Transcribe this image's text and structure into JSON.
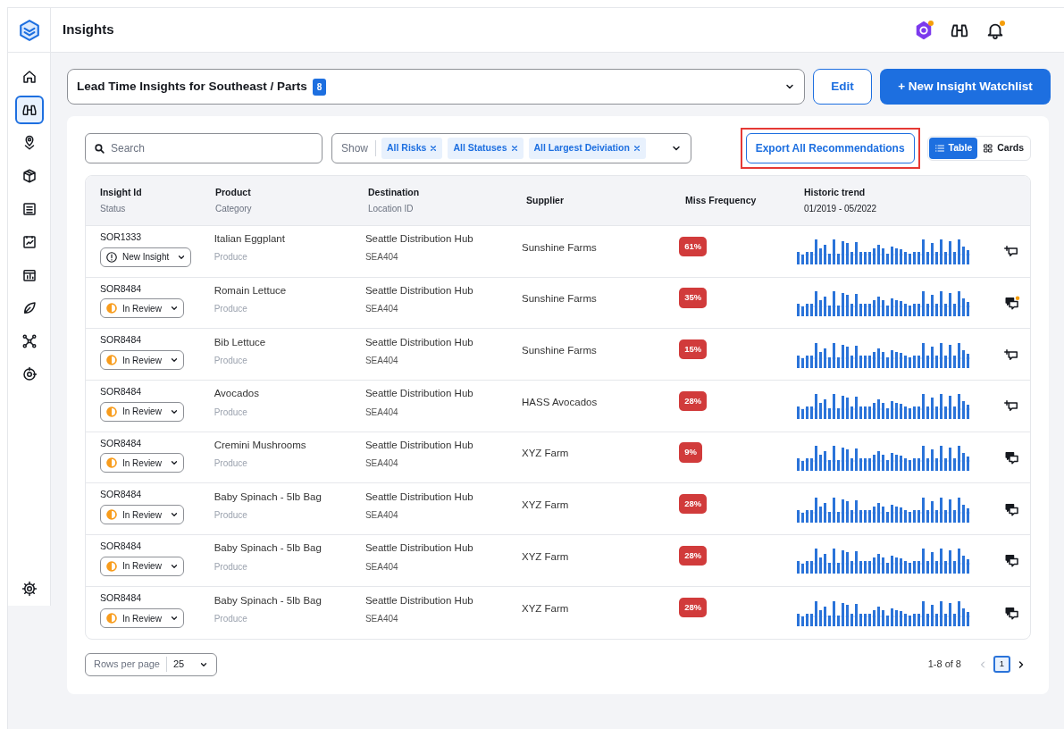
{
  "app": {
    "title": "Insights"
  },
  "sidebar": {
    "items": [
      {
        "kind": "home",
        "selected": false
      },
      {
        "kind": "binoculars",
        "selected": true
      },
      {
        "kind": "pin",
        "selected": false
      },
      {
        "kind": "box",
        "selected": false
      },
      {
        "kind": "list",
        "selected": false
      },
      {
        "kind": "chart",
        "selected": false
      },
      {
        "kind": "report",
        "selected": false
      },
      {
        "kind": "leaf",
        "selected": false
      },
      {
        "kind": "network",
        "selected": false
      },
      {
        "kind": "target",
        "selected": false
      }
    ]
  },
  "topbar": {
    "notifications": [
      {
        "kind": "assistant",
        "dot": true
      },
      {
        "kind": "binoculars",
        "dot": false
      },
      {
        "kind": "bell",
        "dot": true
      }
    ]
  },
  "watchlist": {
    "value": "Lead Time Insights for Southeast / Parts",
    "count": "8",
    "edit": "Edit",
    "new_button": "+ New Insight Watchlist"
  },
  "toolbar": {
    "search_placeholder": "Search",
    "show_label": "Show",
    "filters": [
      "All Risks",
      "All Statuses",
      "All Largest Deiviation"
    ],
    "export": {
      "label": "Export All Recommendations",
      "highlighted": true
    },
    "views": [
      {
        "label": "Table",
        "kind": "list",
        "selected": true
      },
      {
        "label": "Cards",
        "kind": "grid",
        "selected": false
      }
    ]
  },
  "table": {
    "columns": [
      {
        "title": "Insight Id",
        "subtitle": "Status"
      },
      {
        "title": "Product",
        "subtitle": "Category"
      },
      {
        "title": "Destination",
        "subtitle": "Location ID"
      },
      {
        "title": "Supplier"
      },
      {
        "title": "Miss Frequency"
      },
      {
        "title": "Historic trend",
        "subtitle": "01/2019 - 05/2022"
      }
    ],
    "rows": [
      {
        "id": "SOR1333",
        "status": {
          "kind": "new",
          "label": "New Insight"
        },
        "product": "Italian Eggplant",
        "category": "Produce",
        "destination": "Seattle Distribution Hub",
        "location": "SEA404",
        "supplier": "Sunshine Farms",
        "miss": "61%",
        "comment": {
          "kind": "add"
        }
      },
      {
        "id": "SOR8484",
        "status": {
          "kind": "review",
          "label": "In Review"
        },
        "product": "Romain Lettuce",
        "category": "Produce",
        "destination": "Seattle Distribution Hub",
        "location": "SEA404",
        "supplier": "Sunshine Farms",
        "miss": "35%",
        "comment": {
          "kind": "unread"
        }
      },
      {
        "id": "SOR8484",
        "status": {
          "kind": "review",
          "label": "In Review"
        },
        "product": "Bib Lettuce",
        "category": "Produce",
        "destination": "Seattle Distribution Hub",
        "location": "SEA404",
        "supplier": "Sunshine Farms",
        "miss": "15%",
        "comment": {
          "kind": "add"
        }
      },
      {
        "id": "SOR8484",
        "status": {
          "kind": "review",
          "label": "In Review"
        },
        "product": "Avocados",
        "category": "Produce",
        "destination": "Seattle Distribution Hub",
        "location": "SEA404",
        "supplier": "HASS Avocados",
        "miss": "28%",
        "comment": {
          "kind": "add"
        }
      },
      {
        "id": "SOR8484",
        "status": {
          "kind": "review",
          "label": "In Review"
        },
        "product": "Cremini Mushrooms",
        "category": "Produce",
        "destination": "Seattle Distribution Hub",
        "location": "SEA404",
        "supplier": "XYZ Farm",
        "miss": "9%",
        "comment": {
          "kind": "read"
        }
      },
      {
        "id": "SOR8484",
        "status": {
          "kind": "review",
          "label": "In Review"
        },
        "product": "Baby Spinach - 5lb Bag",
        "category": "Produce",
        "destination": "Seattle Distribution Hub",
        "location": "SEA404",
        "supplier": "XYZ Farm",
        "miss": "28%",
        "comment": {
          "kind": "read"
        }
      },
      {
        "id": "SOR8484",
        "status": {
          "kind": "review",
          "label": "In Review"
        },
        "product": "Baby Spinach - 5lb Bag",
        "category": "Produce",
        "destination": "Seattle Distribution Hub",
        "location": "SEA404",
        "supplier": "XYZ Farm",
        "miss": "28%",
        "comment": {
          "kind": "read"
        }
      },
      {
        "id": "SOR8484",
        "status": {
          "kind": "review",
          "label": "In Review"
        },
        "product": "Baby Spinach - 5lb Bag",
        "category": "Produce",
        "destination": "Seattle Distribution Hub",
        "location": "SEA404",
        "supplier": "XYZ Farm",
        "miss": "28%",
        "comment": {
          "kind": "read"
        }
      }
    ]
  },
  "pagination": {
    "rows_label": "Rows per page",
    "rows_value": "25",
    "range": "1-8 of 8",
    "pages": [
      {
        "label": "1",
        "selected": true
      }
    ]
  }
}
